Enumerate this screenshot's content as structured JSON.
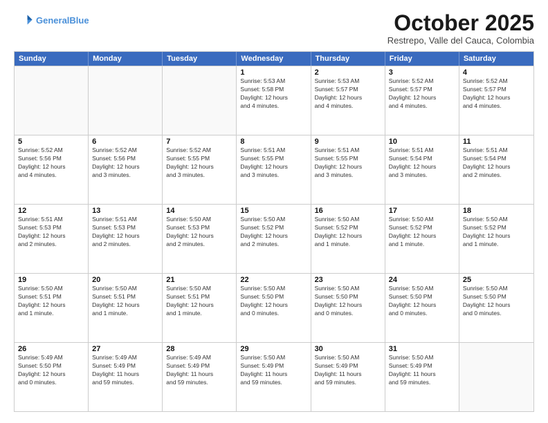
{
  "header": {
    "logo_line1": "General",
    "logo_line2": "Blue",
    "month": "October 2025",
    "location": "Restrepo, Valle del Cauca, Colombia"
  },
  "weekdays": [
    "Sunday",
    "Monday",
    "Tuesday",
    "Wednesday",
    "Thursday",
    "Friday",
    "Saturday"
  ],
  "rows": [
    [
      {
        "day": "",
        "info": ""
      },
      {
        "day": "",
        "info": ""
      },
      {
        "day": "",
        "info": ""
      },
      {
        "day": "1",
        "info": "Sunrise: 5:53 AM\nSunset: 5:58 PM\nDaylight: 12 hours\nand 4 minutes."
      },
      {
        "day": "2",
        "info": "Sunrise: 5:53 AM\nSunset: 5:57 PM\nDaylight: 12 hours\nand 4 minutes."
      },
      {
        "day": "3",
        "info": "Sunrise: 5:52 AM\nSunset: 5:57 PM\nDaylight: 12 hours\nand 4 minutes."
      },
      {
        "day": "4",
        "info": "Sunrise: 5:52 AM\nSunset: 5:57 PM\nDaylight: 12 hours\nand 4 minutes."
      }
    ],
    [
      {
        "day": "5",
        "info": "Sunrise: 5:52 AM\nSunset: 5:56 PM\nDaylight: 12 hours\nand 4 minutes."
      },
      {
        "day": "6",
        "info": "Sunrise: 5:52 AM\nSunset: 5:56 PM\nDaylight: 12 hours\nand 3 minutes."
      },
      {
        "day": "7",
        "info": "Sunrise: 5:52 AM\nSunset: 5:55 PM\nDaylight: 12 hours\nand 3 minutes."
      },
      {
        "day": "8",
        "info": "Sunrise: 5:51 AM\nSunset: 5:55 PM\nDaylight: 12 hours\nand 3 minutes."
      },
      {
        "day": "9",
        "info": "Sunrise: 5:51 AM\nSunset: 5:55 PM\nDaylight: 12 hours\nand 3 minutes."
      },
      {
        "day": "10",
        "info": "Sunrise: 5:51 AM\nSunset: 5:54 PM\nDaylight: 12 hours\nand 3 minutes."
      },
      {
        "day": "11",
        "info": "Sunrise: 5:51 AM\nSunset: 5:54 PM\nDaylight: 12 hours\nand 2 minutes."
      }
    ],
    [
      {
        "day": "12",
        "info": "Sunrise: 5:51 AM\nSunset: 5:53 PM\nDaylight: 12 hours\nand 2 minutes."
      },
      {
        "day": "13",
        "info": "Sunrise: 5:51 AM\nSunset: 5:53 PM\nDaylight: 12 hours\nand 2 minutes."
      },
      {
        "day": "14",
        "info": "Sunrise: 5:50 AM\nSunset: 5:53 PM\nDaylight: 12 hours\nand 2 minutes."
      },
      {
        "day": "15",
        "info": "Sunrise: 5:50 AM\nSunset: 5:52 PM\nDaylight: 12 hours\nand 2 minutes."
      },
      {
        "day": "16",
        "info": "Sunrise: 5:50 AM\nSunset: 5:52 PM\nDaylight: 12 hours\nand 1 minute."
      },
      {
        "day": "17",
        "info": "Sunrise: 5:50 AM\nSunset: 5:52 PM\nDaylight: 12 hours\nand 1 minute."
      },
      {
        "day": "18",
        "info": "Sunrise: 5:50 AM\nSunset: 5:52 PM\nDaylight: 12 hours\nand 1 minute."
      }
    ],
    [
      {
        "day": "19",
        "info": "Sunrise: 5:50 AM\nSunset: 5:51 PM\nDaylight: 12 hours\nand 1 minute."
      },
      {
        "day": "20",
        "info": "Sunrise: 5:50 AM\nSunset: 5:51 PM\nDaylight: 12 hours\nand 1 minute."
      },
      {
        "day": "21",
        "info": "Sunrise: 5:50 AM\nSunset: 5:51 PM\nDaylight: 12 hours\nand 1 minute."
      },
      {
        "day": "22",
        "info": "Sunrise: 5:50 AM\nSunset: 5:50 PM\nDaylight: 12 hours\nand 0 minutes."
      },
      {
        "day": "23",
        "info": "Sunrise: 5:50 AM\nSunset: 5:50 PM\nDaylight: 12 hours\nand 0 minutes."
      },
      {
        "day": "24",
        "info": "Sunrise: 5:50 AM\nSunset: 5:50 PM\nDaylight: 12 hours\nand 0 minutes."
      },
      {
        "day": "25",
        "info": "Sunrise: 5:50 AM\nSunset: 5:50 PM\nDaylight: 12 hours\nand 0 minutes."
      }
    ],
    [
      {
        "day": "26",
        "info": "Sunrise: 5:49 AM\nSunset: 5:50 PM\nDaylight: 12 hours\nand 0 minutes."
      },
      {
        "day": "27",
        "info": "Sunrise: 5:49 AM\nSunset: 5:49 PM\nDaylight: 11 hours\nand 59 minutes."
      },
      {
        "day": "28",
        "info": "Sunrise: 5:49 AM\nSunset: 5:49 PM\nDaylight: 11 hours\nand 59 minutes."
      },
      {
        "day": "29",
        "info": "Sunrise: 5:50 AM\nSunset: 5:49 PM\nDaylight: 11 hours\nand 59 minutes."
      },
      {
        "day": "30",
        "info": "Sunrise: 5:50 AM\nSunset: 5:49 PM\nDaylight: 11 hours\nand 59 minutes."
      },
      {
        "day": "31",
        "info": "Sunrise: 5:50 AM\nSunset: 5:49 PM\nDaylight: 11 hours\nand 59 minutes."
      },
      {
        "day": "",
        "info": ""
      }
    ]
  ]
}
